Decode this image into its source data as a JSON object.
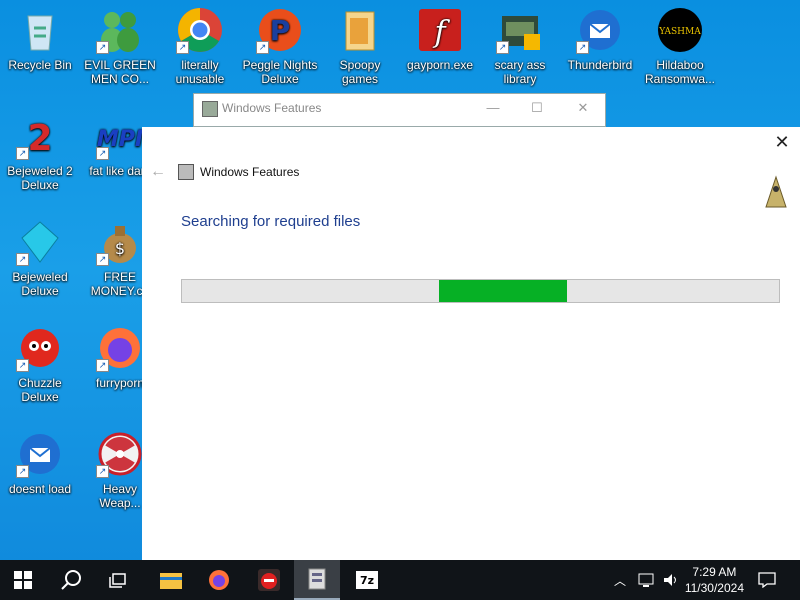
{
  "desktop_icons": [
    {
      "label": "Recycle Bin"
    },
    {
      "label": "EVIL GREEN MEN CO..."
    },
    {
      "label": "literally unusable"
    },
    {
      "label": "Peggle Nights Deluxe"
    },
    {
      "label": "Spoopy games"
    },
    {
      "label": "gayporn.exe"
    },
    {
      "label": "scary ass library"
    },
    {
      "label": "Thunderbird"
    },
    {
      "label": "Hildaboo Ransomwa..."
    },
    {
      "label": "Bejeweled 2 Deluxe"
    },
    {
      "label": "fat like dark"
    },
    {
      "label": "Bejeweled Deluxe"
    },
    {
      "label": "FREE MONEY.co"
    },
    {
      "label": "Chuzzle Deluxe"
    },
    {
      "label": "furryporn"
    },
    {
      "label": "doesnt load"
    },
    {
      "label": "Heavy Weap..."
    }
  ],
  "old_window": {
    "title": "Windows Features",
    "minimize": "—",
    "maximize": "☐",
    "close": "✕"
  },
  "dialog": {
    "title": "Windows Features",
    "heading": "Searching for required files",
    "back": "←",
    "close": "✕",
    "progress": {
      "start_fraction": 0.43,
      "end_fraction": 0.645,
      "color": "#06b025"
    }
  },
  "taskbar": {
    "time": "7:29 AM",
    "date": "11/30/2024",
    "tray_chevron": "︿",
    "zip_label": "7z"
  },
  "colors": {
    "desktop": "#0f88db",
    "taskbar": "#101418",
    "heading": "#1f3f8f"
  }
}
